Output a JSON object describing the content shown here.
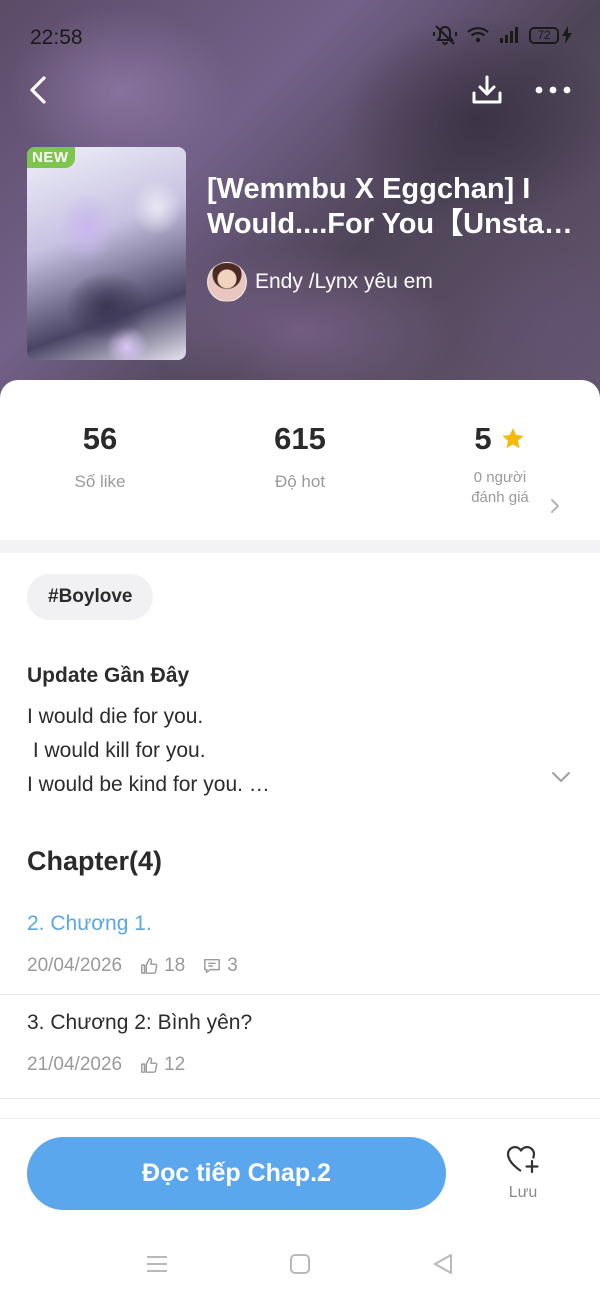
{
  "status_bar": {
    "time": "22:58",
    "battery": "72",
    "icons": [
      "mute-bell-icon",
      "wifi-icon",
      "signal-icon",
      "battery-icon",
      "charging-icon"
    ]
  },
  "nav": {
    "back_icon": "chevron-left-icon",
    "download_icon": "download-icon",
    "more_icon": "more-dots-icon"
  },
  "story": {
    "badge": "NEW",
    "title_line1": "[Wemmbu X Eggchan] I",
    "title_line2": "Would....For You【Unstabl…",
    "author": "Endy /Lynx yêu em"
  },
  "stats": {
    "likes_value": "56",
    "likes_label": "Số like",
    "hot_value": "615",
    "hot_label": "Độ hot",
    "rating_value": "5",
    "rating_label_1": "0 người",
    "rating_label_2": "đánh giá"
  },
  "tag": "#Boylove",
  "update": {
    "heading": "Update Gần Đây",
    "lines": "I would die for you.\n I would kill for you.\nI would be kind for you. …"
  },
  "chapters": {
    "heading": "Chapter(4)",
    "items": [
      {
        "title": "2. Chương 1.",
        "date": "20/04/2026",
        "likes": "18",
        "comments": "3",
        "active": true
      },
      {
        "title": "3. Chương 2: Bình yên?",
        "date": "21/04/2026",
        "likes": "12",
        "active": false
      }
    ]
  },
  "actions": {
    "continue_label": "Đọc tiếp Chap.2",
    "save_label": "Lưu"
  },
  "colors": {
    "accent": "#5aa7ee",
    "active_chapter": "#5aa7e8",
    "new_badge": "#7bc64b",
    "star": "#f5b90a"
  }
}
